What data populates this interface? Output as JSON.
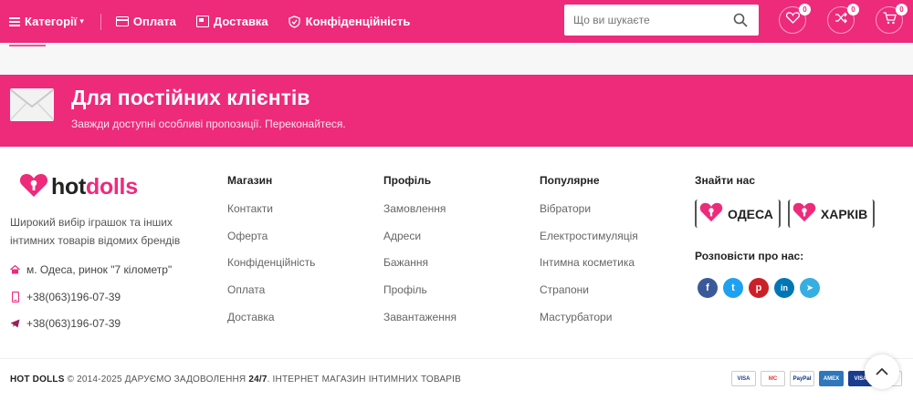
{
  "header": {
    "categories_label": "Категорії",
    "nav": [
      {
        "label": "Оплата",
        "icon": "card-icon"
      },
      {
        "label": "Доставка",
        "icon": "delivery-icon"
      },
      {
        "label": "Конфіденційність",
        "icon": "shield-icon"
      }
    ],
    "search_placeholder": "Що ви шукаєте",
    "wishlist_count": "0",
    "compare_count": "0",
    "cart_count": "0"
  },
  "banner": {
    "title": "Для постійних клієнтів",
    "subtitle": "Завжди доступні особливі пропозиції. Переконайтеся."
  },
  "footer": {
    "logo": {
      "hot": "hot",
      "dolls": "dolls"
    },
    "description": "Широкий вибір іграшок та інших інтимних товарів відомих брендів",
    "address": "м. Одеса, ринок \"7 кілометр\"",
    "phone1": "+38(063)196-07-39",
    "phone2": "+38(063)196-07-39",
    "columns": [
      {
        "title": "Магазин",
        "links": [
          "Контакти",
          "Оферта",
          "Конфіденційність",
          "Оплата",
          "Доставка"
        ]
      },
      {
        "title": "Профіль",
        "links": [
          "Замовлення",
          "Адреси",
          "Бажання",
          "Профіль",
          "Завантаження"
        ]
      },
      {
        "title": "Популярне",
        "links": [
          "Вібратори",
          "Електростимуляція",
          "Інтимна косметика",
          "Страпони",
          "Мастурбатори"
        ]
      }
    ],
    "find_us": "Знайти нас",
    "cities": [
      "ОДЕСА",
      "ХАРКІВ"
    ],
    "share_label": "Розповісти про нас:",
    "socials": [
      {
        "name": "facebook",
        "letter": "f",
        "color": "#3b5998"
      },
      {
        "name": "twitter",
        "letter": "t",
        "color": "#1da1f2"
      },
      {
        "name": "pinterest",
        "letter": "p",
        "color": "#cb2027"
      },
      {
        "name": "linkedin",
        "letter": "in",
        "color": "#0077b5"
      },
      {
        "name": "telegram",
        "letter": "➤",
        "color": "#37aee2"
      }
    ],
    "copyright": {
      "brand": "HOT DOLLS",
      "symbol": "©",
      "years": "2014-2025 ДАРУЄМО ЗАДОВОЛЕННЯ",
      "hours": "24/7",
      "rest": ". ІНТЕРНЕТ МАГАЗИН ІНТИМНИХ ТОВАРІВ"
    },
    "payments": [
      "VISA",
      "MC",
      "PayPal",
      "AMEX",
      "VISA",
      "DISC"
    ]
  },
  "colors": {
    "brand": "#ee2a7b"
  }
}
